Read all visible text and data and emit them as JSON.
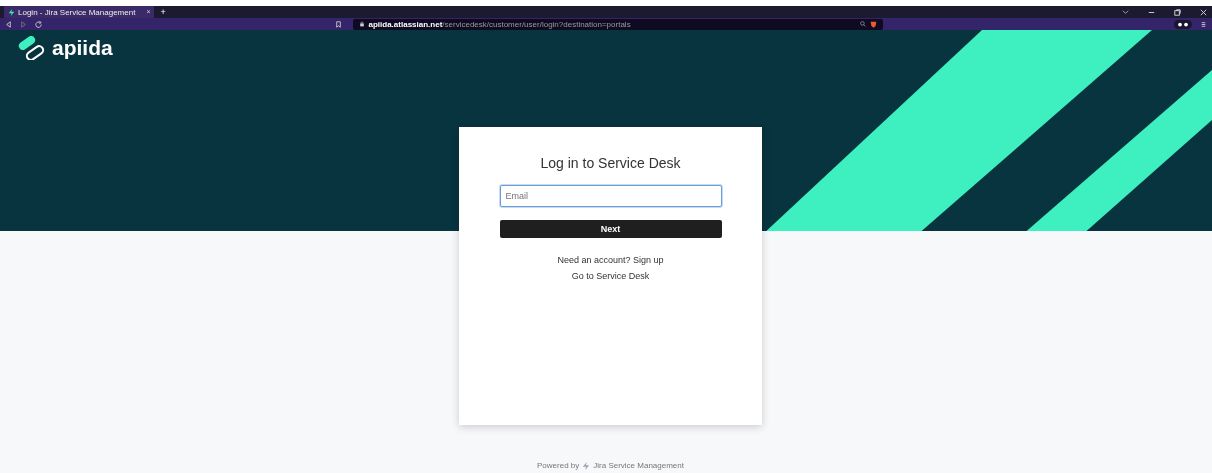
{
  "browser": {
    "tab_title": "Login - Jira Service Management",
    "tab_close": "×",
    "new_tab": "+",
    "url": "**apiida.atlassian.net**/servicedesk/customer/user/login?destination=portals"
  },
  "brand": {
    "name": "apiida"
  },
  "login": {
    "title": "Log in to Service Desk",
    "email": {
      "placeholder": "Email",
      "focused": true
    },
    "submit": "Next",
    "signup_prompt": "Need an account? Sign up",
    "portal_link": "Go to Service Desk"
  },
  "footer": {
    "prefix": "Powered by",
    "product": "Jira Service Management"
  }
}
